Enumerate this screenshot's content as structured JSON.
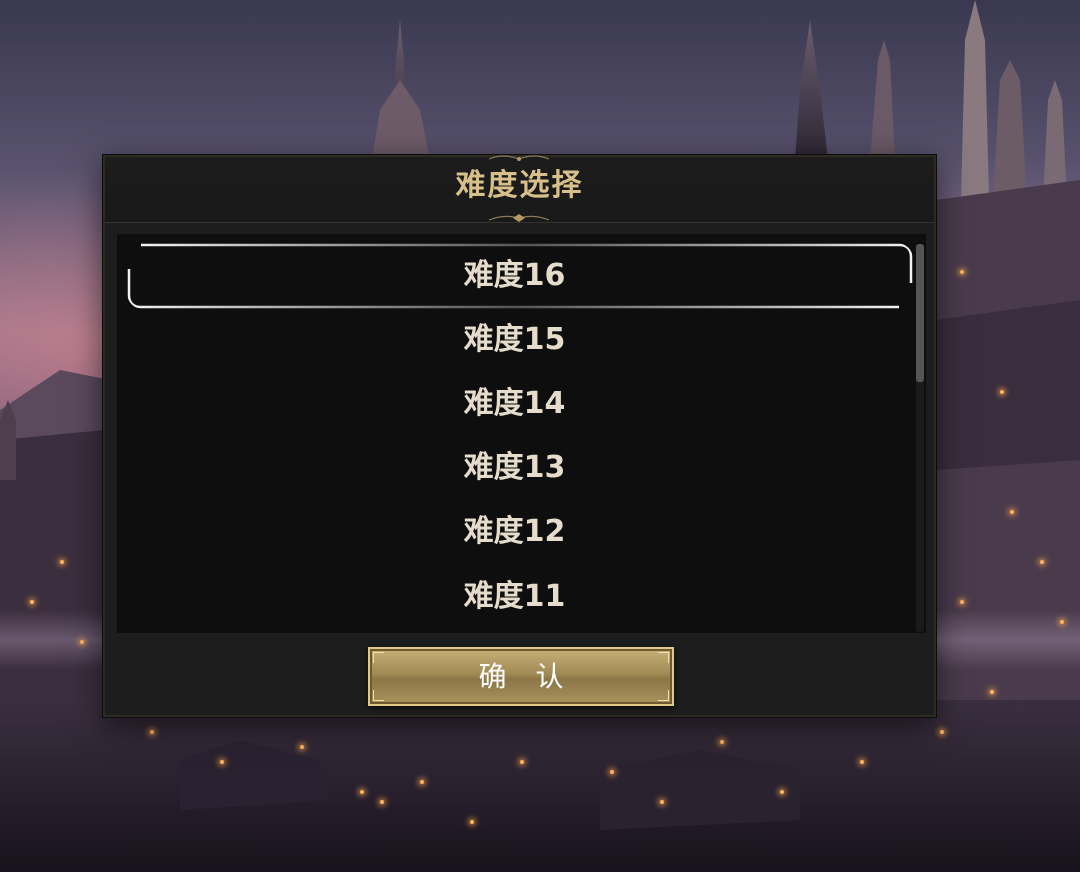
{
  "dialog": {
    "title": "难度选择",
    "confirm_label": "确 认"
  },
  "difficulty_list": {
    "items": [
      {
        "label": "难度16",
        "selected": true
      },
      {
        "label": "难度15",
        "selected": false
      },
      {
        "label": "难度14",
        "selected": false
      },
      {
        "label": "难度13",
        "selected": false
      },
      {
        "label": "难度12",
        "selected": false
      },
      {
        "label": "难度11",
        "selected": false
      }
    ]
  },
  "colors": {
    "title_gold": "#d8c08a",
    "item_text": "#e6dccb",
    "button_gold": "#a08a55",
    "panel_bg": "#0e0e0e",
    "dialog_bg": "#1d1d1d"
  }
}
